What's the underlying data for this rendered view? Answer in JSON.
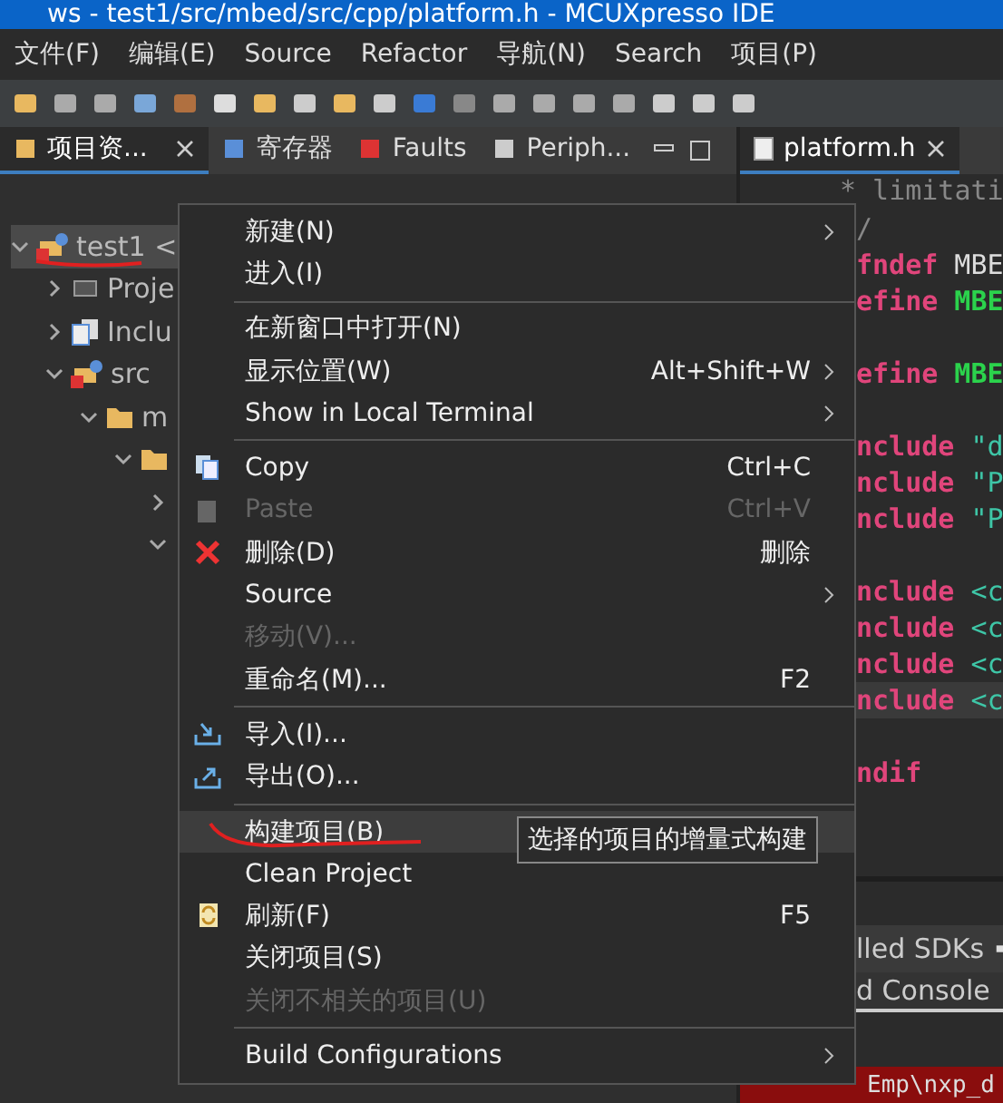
{
  "window": {
    "title": "ws - test1/src/mbed/src/cpp/platform.h - MCUXpresso IDE"
  },
  "menubar": [
    "文件(F)",
    "编辑(E)",
    "Source",
    "Refactor",
    "导航(N)",
    "Search",
    "项目(P)"
  ],
  "left_panel": {
    "tabs": [
      {
        "label": "项目资...",
        "selected": true,
        "closable": true
      },
      {
        "label": "寄存器",
        "selected": false,
        "closable": false
      },
      {
        "label": "Faults",
        "selected": false,
        "closable": false
      },
      {
        "label": "Periph...",
        "selected": false,
        "closable": false
      }
    ],
    "tree": [
      {
        "label": "test1 <",
        "expanded": true,
        "selected": true,
        "children": [
          {
            "label": "Proje",
            "expanded": false,
            "selected": false
          },
          {
            "label": "Inclu",
            "expanded": false,
            "selected": false
          },
          {
            "label": "src",
            "expanded": true,
            "selected": false,
            "children": [
              {
                "label": "m",
                "expanded": true,
                "selected": false,
                "children": [
                  {
                    "expanded": true,
                    "selected": false,
                    "children": [
                      {
                        "expanded": false,
                        "selected": false
                      },
                      {
                        "expanded": true,
                        "selected": false
                      }
                    ]
                  }
                ]
              }
            ]
          }
        ]
      }
    ]
  },
  "editor": {
    "tab": {
      "label": "platform.h",
      "selected": true
    },
    "lines": [
      {
        "kind": "top",
        "parts": [
          {
            "text": "* limitati",
            "kind": "comment"
          }
        ]
      },
      {
        "parts": [
          {
            "text": "/",
            "kind": "comment"
          }
        ]
      },
      {
        "parts": [
          {
            "text": "fndef",
            "kind": "keyword"
          },
          {
            "text": " MBE",
            "kind": "plain"
          }
        ]
      },
      {
        "parts": [
          {
            "text": "efine",
            "kind": "keyword"
          },
          {
            "text": " MBE",
            "kind": "macro"
          }
        ]
      },
      {
        "kind": "blank"
      },
      {
        "parts": [
          {
            "text": "efine",
            "kind": "keyword"
          },
          {
            "text": " MBE",
            "kind": "macro"
          }
        ]
      },
      {
        "kind": "blank"
      },
      {
        "parts": [
          {
            "text": "nclude",
            "kind": "keyword"
          },
          {
            "text": " \"d",
            "kind": "string"
          }
        ]
      },
      {
        "parts": [
          {
            "text": "nclude",
            "kind": "keyword"
          },
          {
            "text": " \"P",
            "kind": "string"
          }
        ]
      },
      {
        "parts": [
          {
            "text": "nclude",
            "kind": "keyword"
          },
          {
            "text": " \"P",
            "kind": "string"
          }
        ]
      },
      {
        "kind": "blank"
      },
      {
        "parts": [
          {
            "text": "nclude",
            "kind": "keyword"
          },
          {
            "text": " <c",
            "kind": "string"
          }
        ]
      },
      {
        "parts": [
          {
            "text": "nclude",
            "kind": "keyword"
          },
          {
            "text": " <c",
            "kind": "string"
          }
        ]
      },
      {
        "parts": [
          {
            "text": "nclude",
            "kind": "keyword"
          },
          {
            "text": " <c",
            "kind": "string"
          }
        ]
      },
      {
        "current": true,
        "parts": [
          {
            "text": "nclude",
            "kind": "keyword"
          },
          {
            "text": " <c",
            "kind": "string"
          }
        ]
      },
      {
        "kind": "blank"
      },
      {
        "parts": [
          {
            "text": "ndif",
            "kind": "keyword"
          }
        ]
      }
    ]
  },
  "bottom_panel": {
    "tabs": [
      "lled SDKs"
    ],
    "console_title": "d Console",
    "error_line": "Emp\\nxp_d"
  },
  "context_menu": {
    "items": [
      {
        "kind": "item",
        "label": "新建(N)",
        "submenu": true,
        "disabled": false,
        "selected": false
      },
      {
        "kind": "item",
        "label": "进入(I)",
        "disabled": false,
        "selected": false
      },
      {
        "kind": "separator"
      },
      {
        "kind": "item",
        "label": "在新窗口中打开(N)",
        "disabled": false,
        "selected": false
      },
      {
        "kind": "item",
        "label": "显示位置(W)",
        "shortcut": "Alt+Shift+W",
        "submenu": true,
        "disabled": false,
        "selected": false
      },
      {
        "kind": "item",
        "label": "Show in Local Terminal",
        "submenu": true,
        "disabled": false,
        "selected": false
      },
      {
        "kind": "separator"
      },
      {
        "kind": "item",
        "label": "Copy",
        "shortcut": "Ctrl+C",
        "disabled": false,
        "selected": false
      },
      {
        "kind": "item",
        "label": "Paste",
        "shortcut": "Ctrl+V",
        "disabled": true,
        "selected": false
      },
      {
        "kind": "item",
        "label": "删除(D)",
        "shortcut": "删除",
        "disabled": false,
        "selected": false
      },
      {
        "kind": "item",
        "label": "Source",
        "submenu": true,
        "disabled": false,
        "selected": false
      },
      {
        "kind": "item",
        "label": "移动(V)...",
        "disabled": true,
        "selected": false
      },
      {
        "kind": "item",
        "label": "重命名(M)...",
        "shortcut": "F2",
        "disabled": false,
        "selected": false
      },
      {
        "kind": "separator"
      },
      {
        "kind": "item",
        "label": "导入(I)...",
        "disabled": false,
        "selected": false
      },
      {
        "kind": "item",
        "label": "导出(O)...",
        "disabled": false,
        "selected": false
      },
      {
        "kind": "separator"
      },
      {
        "kind": "item",
        "label": "构建项目(B)",
        "disabled": false,
        "selected": true
      },
      {
        "kind": "item",
        "label": "Clean Project",
        "disabled": false,
        "selected": false
      },
      {
        "kind": "item",
        "label": "刷新(F)",
        "shortcut": "F5",
        "disabled": false,
        "selected": false
      },
      {
        "kind": "item",
        "label": "关闭项目(S)",
        "disabled": false,
        "selected": false
      },
      {
        "kind": "item",
        "label": "关闭不相关的项目(U)",
        "disabled": true,
        "selected": false
      },
      {
        "kind": "separator"
      },
      {
        "kind": "item",
        "label": "Build Configurations",
        "submenu": true,
        "disabled": false,
        "selected": false
      }
    ]
  },
  "tooltip": "选择的项目的增量式构建"
}
